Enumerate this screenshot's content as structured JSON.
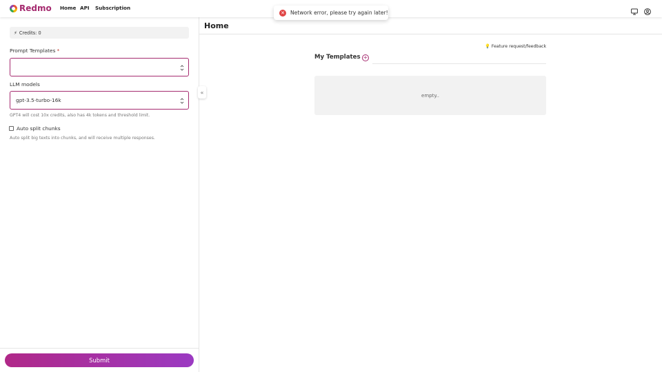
{
  "nav": {
    "brand": "Redmo",
    "links": [
      "Home",
      "API",
      "Subscription"
    ]
  },
  "toast": {
    "message": "Network error, please try again later!",
    "icon": "error-x-icon"
  },
  "left": {
    "credits": "Credits: 0",
    "prompt_templates": {
      "label": "Prompt Templates",
      "required": "*",
      "value": ""
    },
    "llm_models": {
      "label": "LLM models",
      "value": "gpt-3.5-turbo-16k",
      "hint": "GPT4 will cost 10x credits, also has 4k tokens and threshold limit."
    },
    "auto_split": {
      "label": "Auto split chunks",
      "checked": false,
      "hint": "Auto split big texts into chunks, and will receive multiple responses."
    },
    "submit": "Submit"
  },
  "main": {
    "title": "Home",
    "feedback": "Feature request/feedback",
    "templates_title": "My Templates",
    "empty_text": "empty.."
  },
  "colors": {
    "brand": "#a52a6f",
    "submit_gradient_start": "#b02888",
    "submit_gradient_end": "#9b3ac2",
    "error": "#e04444"
  }
}
